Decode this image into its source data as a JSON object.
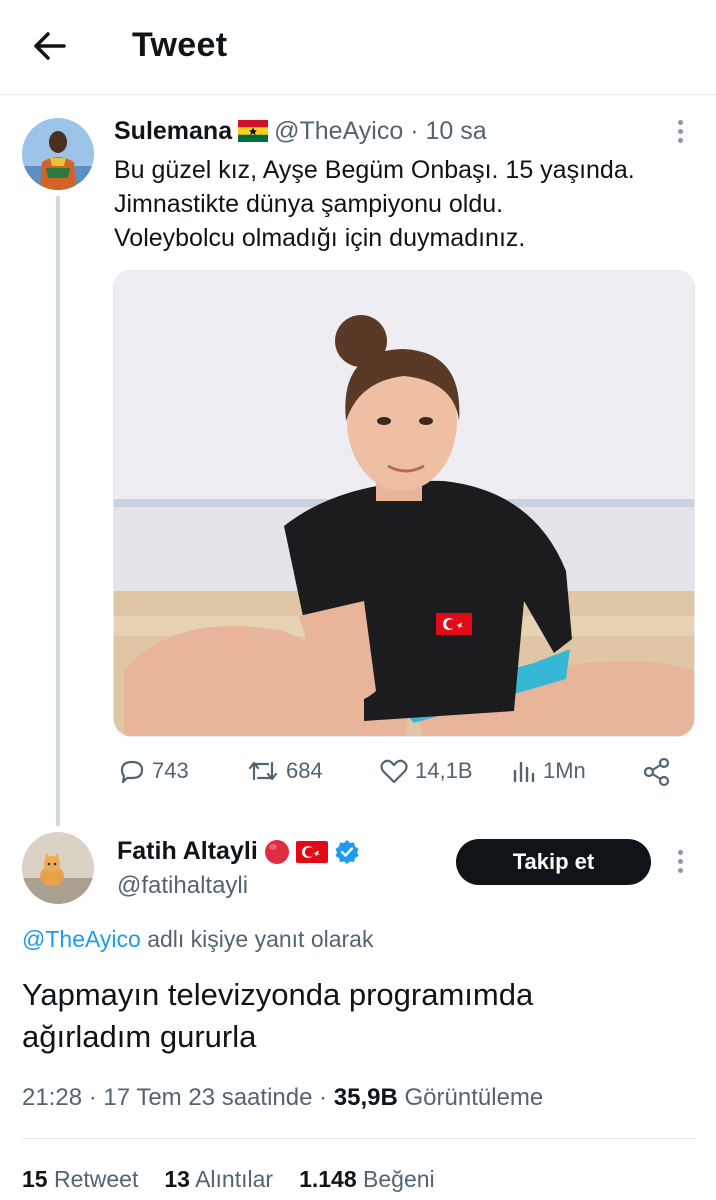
{
  "header": {
    "title": "Tweet",
    "back_icon": "arrow-left-icon"
  },
  "quoted_tweet": {
    "author_name": "Sulemana",
    "author_flag": "ghana-flag-emoji",
    "handle": "@TheAyico",
    "separator": "·",
    "time_ago": "10 sa",
    "text_lines": [
      "Bu güzel kız, Ayşe Begüm Onbaşı. 15 yaşında.",
      "Jimnastikte dünya şampiyonu oldu.",
      "Voleybolcu olmadığı için duymadınız."
    ],
    "actions": {
      "replies": "743",
      "retweets": "684",
      "likes": "14,1B",
      "views": "1Mn"
    }
  },
  "reply_tweet": {
    "author_name": "Fatih Altayli",
    "author_badges": [
      "red-circle-emoji",
      "turkey-flag-emoji",
      "verified-badge-icon"
    ],
    "handle": "@fatihaltayli",
    "follow_label": "Takip et",
    "replying_mention": "@TheAyico",
    "replying_suffix": "adlı kişiye yanıt olarak",
    "text_lines": [
      "Yapmayın televizyonda programımda",
      "ağırladım gururla"
    ],
    "meta": {
      "time": "21:28",
      "sep1": "·",
      "date": "17 Tem 23 saatinde",
      "sep2": "·",
      "views_count": "35,9B",
      "views_label": "Görüntüleme"
    },
    "stats": {
      "retweets_count": "15",
      "retweets_label": "Retweet",
      "quotes_count": "13",
      "quotes_label": "Alıntılar",
      "likes_count": "1.148",
      "likes_label": "Beğeni"
    }
  },
  "colors": {
    "accent": "#1d9bf0",
    "text_primary": "#0f1419",
    "text_secondary": "#536471",
    "follow_button_bg": "#0f1419",
    "thread_line": "#cfd9de"
  }
}
